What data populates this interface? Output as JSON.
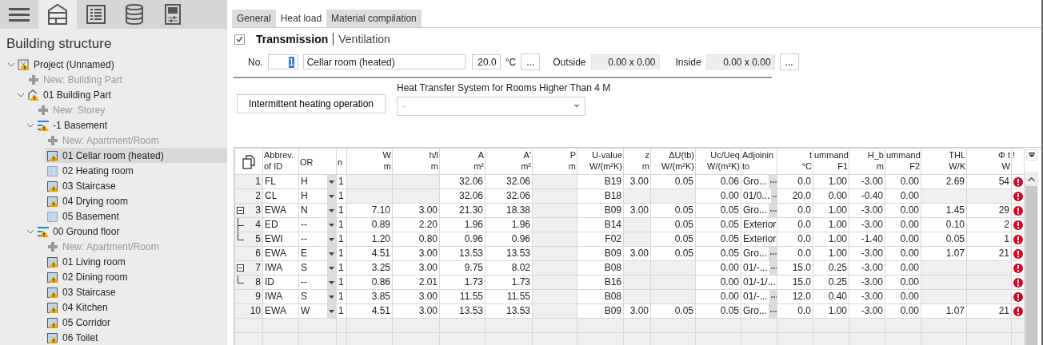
{
  "toolbar": {
    "items": [
      {
        "kind": "menu",
        "selected": false
      },
      {
        "kind": "building",
        "selected": true
      },
      {
        "kind": "list",
        "selected": false
      },
      {
        "kind": "database",
        "selected": false
      },
      {
        "kind": "panel",
        "selected": false
      }
    ]
  },
  "sidebar": {
    "title": "Building structure",
    "tree": [
      {
        "kind": "project",
        "label": "Project (Unnamed)",
        "selected": false,
        "expanded": true,
        "children": [
          {
            "kind": "add",
            "label": "New: Building Part",
            "selected": false
          },
          {
            "kind": "building_part",
            "label": "01 Building Part",
            "selected": false,
            "expanded": true,
            "children": [
              {
                "kind": "add",
                "label": "New: Storey",
                "selected": false
              },
              {
                "kind": "storey",
                "label": "-1 Basement",
                "selected": false,
                "expanded": true,
                "children": [
                  {
                    "kind": "add",
                    "label": "New: Apartment/Room",
                    "selected": false
                  },
                  {
                    "kind": "room_warning",
                    "label": "01 Cellar room (heated)",
                    "selected": true
                  },
                  {
                    "kind": "room",
                    "label": "02 Heating room",
                    "selected": false
                  },
                  {
                    "kind": "room_warning",
                    "label": "03 Staircase",
                    "selected": false
                  },
                  {
                    "kind": "room_warning",
                    "label": "04 Drying room",
                    "selected": false
                  },
                  {
                    "kind": "room",
                    "label": "05 Basement",
                    "selected": false
                  }
                ]
              },
              {
                "kind": "storey",
                "label": "00 Ground floor",
                "selected": false,
                "expanded": true,
                "children": [
                  {
                    "kind": "add",
                    "label": "New: Apartment/Room",
                    "selected": false
                  },
                  {
                    "kind": "room_warning",
                    "label": "01 Living room",
                    "selected": false
                  },
                  {
                    "kind": "room_warning",
                    "label": "02 Dining room",
                    "selected": false
                  },
                  {
                    "kind": "room_warning",
                    "label": "03 Staircase",
                    "selected": false
                  },
                  {
                    "kind": "room_warning",
                    "label": "04 Kitchen",
                    "selected": false
                  },
                  {
                    "kind": "room_warning",
                    "label": "05 Corridor",
                    "selected": false
                  },
                  {
                    "kind": "room_warning",
                    "label": "06 Toilet",
                    "selected": false
                  }
                ]
              }
            ]
          }
        ]
      }
    ]
  },
  "tabs": [
    {
      "label": "General",
      "selected": false
    },
    {
      "label": "Heat load",
      "selected": true
    },
    {
      "label": "Material compilation",
      "selected": false
    }
  ],
  "transmission": {
    "checked": true,
    "views": [
      {
        "label": "Transmission",
        "selected": true
      },
      {
        "label": "Ventilation",
        "selected": false
      }
    ]
  },
  "room_form": {
    "no_label": "No.",
    "no_value": "1",
    "name_value": "Cellar room (heated)",
    "temperature": "20.0",
    "unit": "°C",
    "more_button": "...",
    "outside_label": "Outside",
    "outside_value": "0.00 x 0.00",
    "inside_label": "Inside",
    "inside_value": "0.00 x 0.00",
    "inside_more_button": "..."
  },
  "options": {
    "intermittent_button": "Intermittent heating operation",
    "heat_transfer_label": "Heat Transfer System for Rooms Higher Than 4 M",
    "heat_transfer_value": "-",
    "heat_transfer_disabled": true
  },
  "table": {
    "columns": [
      {
        "kind": "rownum"
      },
      {
        "kind": "text",
        "label": "Abbrev.",
        "unit": "of ID"
      },
      {
        "kind": "dropdown",
        "label": "OR"
      },
      {
        "kind": "text",
        "label": "n"
      },
      {
        "kind": "number",
        "label": "W",
        "unit": "m"
      },
      {
        "kind": "number",
        "label": "h/l",
        "unit": "m"
      },
      {
        "kind": "number",
        "label": "A",
        "unit": "m²"
      },
      {
        "kind": "number",
        "label": "A'",
        "unit": "m²"
      },
      {
        "kind": "number",
        "label": "P",
        "unit": "m"
      },
      {
        "kind": "number",
        "label": "U-value",
        "unit": "W/(m²K)"
      },
      {
        "kind": "number",
        "label": "z",
        "unit": "m"
      },
      {
        "kind": "number",
        "label": "ΔU(tb)",
        "unit": "W/(m²K)"
      },
      {
        "kind": "number",
        "label": "Uc/Ueq",
        "unit": "W/(m²K)"
      },
      {
        "kind": "picker",
        "label": "Adjoinin",
        "unit": "to"
      },
      {
        "kind": "number",
        "label": "t",
        "unit": "°C"
      },
      {
        "kind": "number",
        "label": "ummand",
        "unit": "F1"
      },
      {
        "kind": "number",
        "label": "H_b",
        "unit": "m"
      },
      {
        "kind": "number",
        "label": "ummand",
        "unit": "F2"
      },
      {
        "kind": "number",
        "label": "THL",
        "unit": "W/K"
      },
      {
        "kind": "number",
        "label": "Φ t",
        "unit": "W"
      },
      {
        "kind": "status",
        "label": "!"
      }
    ],
    "rows": [
      {
        "cells": [
          "1",
          "FL",
          "H",
          "1",
          null,
          null,
          "32.06",
          "32.06",
          null,
          "B19",
          "3.00",
          "0.05",
          "0.06",
          "Gro...",
          "0.0",
          "1.00",
          "-3.00",
          "0.00",
          "2.69",
          "54"
        ],
        "picker": true,
        "error": true
      },
      {
        "cells": [
          "2",
          "CL",
          "H",
          "1",
          null,
          null,
          "32.06",
          "32.06",
          null,
          "B18",
          null,
          null,
          "0.00",
          "01/0...",
          "20.0",
          "0.00",
          "-0.40",
          "0.00",
          null,
          null
        ],
        "picker": true,
        "error": true
      },
      {
        "cells": [
          "3",
          "EWA",
          "N",
          "1",
          "7.10",
          "3.00",
          "21.30",
          "18.38",
          null,
          "B09",
          "3.00",
          "0.05",
          "0.05",
          "Gro...",
          "0.0",
          "1.00",
          "-3.00",
          "0.00",
          "1.45",
          "29"
        ],
        "picker": true,
        "error": true,
        "expanded": true,
        "children": [
          {
            "cells": [
              "4",
              "ED",
              "--",
              "1",
              "0.89",
              "2.20",
              "1.96",
              "1.96",
              null,
              "B14",
              null,
              "0.05",
              "0.05",
              "Exterior",
              "0.0",
              "1.00",
              "-3.00",
              "0.00",
              "0.10",
              "2"
            ],
            "picker": false,
            "error": true
          },
          {
            "cells": [
              "5",
              "EWI",
              "--",
              "1",
              "1.20",
              "0.80",
              "0.96",
              "0.96",
              null,
              "F02",
              null,
              "0.05",
              "0.05",
              "Exterior",
              "0.0",
              "1.00",
              "-1.40",
              "0.00",
              "0.05",
              "1"
            ],
            "picker": false,
            "error": true
          }
        ]
      },
      {
        "cells": [
          "6",
          "EWA",
          "E",
          "1",
          "4.51",
          "3.00",
          "13.53",
          "13.53",
          null,
          "B09",
          "3.00",
          "0.05",
          "0.05",
          "Gro...",
          "0.0",
          "1.00",
          "-3.00",
          "0.00",
          "1.07",
          "21"
        ],
        "picker": true,
        "error": true
      },
      {
        "cells": [
          "7",
          "IWA",
          "S",
          "1",
          "3.25",
          "3.00",
          "9.75",
          "8.02",
          null,
          "B08",
          null,
          null,
          "0.00",
          "01/-...",
          "15.0",
          "0.25",
          "-3.00",
          "0.00",
          null,
          null
        ],
        "picker": true,
        "error": true,
        "expanded": true,
        "children": [
          {
            "cells": [
              "8",
              "ID",
              "--",
              "1",
              "0.86",
              "2.01",
              "1.73",
              "1.73",
              null,
              "B16",
              null,
              null,
              "0.00",
              "01/-1/...",
              "15.0",
              "0.25",
              "-3.00",
              "0.00",
              null,
              null
            ],
            "picker": false,
            "error": true
          }
        ]
      },
      {
        "cells": [
          "9",
          "IWA",
          "S",
          "1",
          "3.85",
          "3.00",
          "11.55",
          "11.55",
          null,
          "B08",
          null,
          null,
          "0.00",
          "01/-...",
          "12.0",
          "0.40",
          "-3.00",
          "0.00",
          null,
          null
        ],
        "picker": true,
        "error": true
      },
      {
        "cells": [
          "10",
          "EWA",
          "W",
          "1",
          "4.51",
          "3.00",
          "13.53",
          "13.53",
          null,
          "B09",
          "3.00",
          "0.05",
          "0.05",
          "Gro...",
          "0.0",
          "1.00",
          "-3.00",
          "0.00",
          "1.07",
          "21"
        ],
        "picker": true,
        "error": true
      }
    ]
  }
}
